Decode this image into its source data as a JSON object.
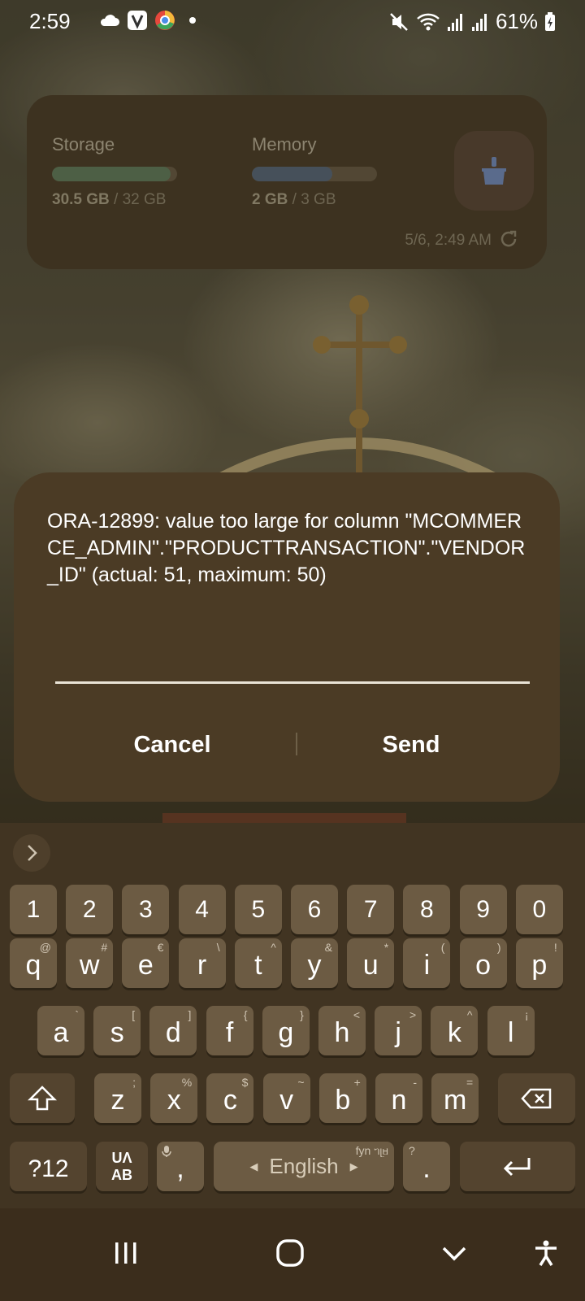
{
  "status_bar": {
    "time": "2:59",
    "icons_left": [
      "cloud-icon",
      "v-app-icon",
      "chrome-like-app-icon",
      "dot-icon"
    ],
    "icons_right": [
      "mute-icon",
      "wifi-icon",
      "signal-icon",
      "signal-icon"
    ],
    "battery": "61%"
  },
  "widget": {
    "storage": {
      "label": "Storage",
      "used": "30.5 GB",
      "total": " / 32 GB",
      "fraction": 0.95
    },
    "memory": {
      "label": "Memory",
      "used": "2 GB",
      "total": " / 3 GB",
      "fraction": 0.64
    },
    "timestamp": "5/6, 2:49 AM",
    "colors": {
      "storage_fill": "#4d5f45",
      "memory_fill": "#46505a"
    }
  },
  "dialog": {
    "message": "ORA-12899: value too large for column \"MCOMMERCE_ADMIN\".\"PRODUCTTRANSACTION\".\"VENDOR_ID\" (actual: 51, maximum: 50)",
    "input_value": "",
    "cancel_label": "Cancel",
    "send_label": "Send"
  },
  "keyboard": {
    "digits": [
      "1",
      "2",
      "3",
      "4",
      "5",
      "6",
      "7",
      "8",
      "9",
      "0"
    ],
    "row1": [
      {
        "k": "q",
        "h": "@"
      },
      {
        "k": "w",
        "h": "#"
      },
      {
        "k": "e",
        "h": "€"
      },
      {
        "k": "r",
        "h": "\\"
      },
      {
        "k": "t",
        "h": "^"
      },
      {
        "k": "y",
        "h": "&"
      },
      {
        "k": "u",
        "h": "*"
      },
      {
        "k": "i",
        "h": "("
      },
      {
        "k": "o",
        "h": ")"
      },
      {
        "k": "p",
        "h": "!"
      }
    ],
    "row2": [
      {
        "k": "a",
        "h": "`"
      },
      {
        "k": "s",
        "h": "["
      },
      {
        "k": "d",
        "h": "]"
      },
      {
        "k": "f",
        "h": "{"
      },
      {
        "k": "g",
        "h": "}"
      },
      {
        "k": "h",
        "h": "<"
      },
      {
        "k": "j",
        "h": ">"
      },
      {
        "k": "k",
        "h": "^"
      },
      {
        "k": "l",
        "h": "¡"
      }
    ],
    "row3": [
      {
        "k": "z",
        "h": ";"
      },
      {
        "k": "x",
        "h": "%"
      },
      {
        "k": "c",
        "h": "$"
      },
      {
        "k": "v",
        "h": "~"
      },
      {
        "k": "b",
        "h": "+"
      },
      {
        "k": "n",
        "h": "-"
      },
      {
        "k": "m",
        "h": "="
      }
    ],
    "symbols_label": "?12",
    "lang_switch_top": "UΛ",
    "lang_switch_bottom": "AB",
    "comma": ",",
    "space_label": "English",
    "space_hint": "fyn ᥐᥨᥛ",
    "period": ".",
    "period_hint": "?"
  },
  "navbar": {
    "icons": [
      "recents-icon",
      "home-icon",
      "hide-keyboard-icon",
      "accessibility-icon"
    ]
  }
}
